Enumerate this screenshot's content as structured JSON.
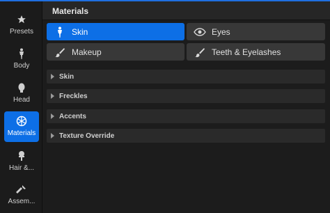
{
  "sidebar": {
    "items": [
      {
        "label": "Presets",
        "icon": "star-icon"
      },
      {
        "label": "Body",
        "icon": "body-icon"
      },
      {
        "label": "Head",
        "icon": "head-icon"
      },
      {
        "label": "Materials",
        "icon": "materials-icon",
        "active": true
      },
      {
        "label": "Hair &...",
        "icon": "hair-icon"
      },
      {
        "label": "Assem...",
        "icon": "hammer-icon"
      }
    ]
  },
  "panel": {
    "title": "Materials",
    "materials": [
      {
        "label": "Skin",
        "icon": "skin-figure-icon",
        "active": true
      },
      {
        "label": "Eyes",
        "icon": "eye-icon"
      },
      {
        "label": "Makeup",
        "icon": "brush-icon"
      },
      {
        "label": "Teeth & Eyelashes",
        "icon": "brush-icon"
      }
    ],
    "sections": [
      {
        "label": "Skin"
      },
      {
        "label": "Freckles"
      },
      {
        "label": "Accents"
      },
      {
        "label": "Texture Override"
      }
    ]
  },
  "colors": {
    "accent": "#0d6fe6",
    "background": "#1c1c1c",
    "button": "#383838"
  }
}
